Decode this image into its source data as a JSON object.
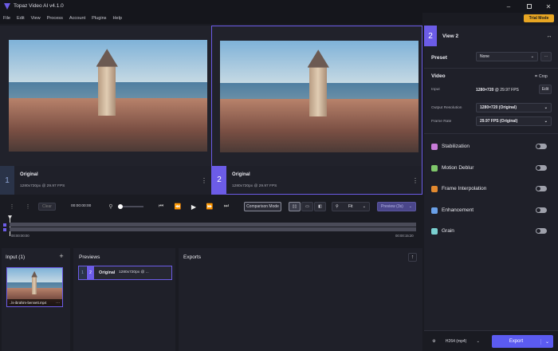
{
  "app": {
    "title": "Topaz Video AI  v4.1.0",
    "trial": "Trial Mode"
  },
  "menu": [
    "File",
    "Edit",
    "View",
    "Process",
    "Account",
    "Plugins",
    "Help"
  ],
  "viewers": [
    {
      "num": "1",
      "name": "Original",
      "info": "1280x720px @ 29.97 FPS"
    },
    {
      "num": "2",
      "name": "Original",
      "info": "1280x720px @ 29.97 FPS"
    }
  ],
  "timeline": {
    "clear": "Clear",
    "time": "00:00:00:00",
    "comparison": "Comparison Mode",
    "zoom": "Fit",
    "preview": "Preview (3s)",
    "start": "00:00:00:00",
    "end": "00:00:15:20"
  },
  "input": {
    "title": "Input (1)",
    "file": "..ls-ibrahim-bennett.mp4"
  },
  "previews": {
    "title": "Previews",
    "num_a": "1",
    "num_b": "2",
    "name": "Original",
    "info": "1280x720px @ ..."
  },
  "exports": {
    "title": "Exports"
  },
  "side": {
    "view_num": "2",
    "view_title": "View 2",
    "preset_label": "Preset",
    "preset_value": "None",
    "video_label": "Video",
    "crop": "Crop",
    "input_label": "Input",
    "input_value_a": "1280×720",
    "input_value_b": "@ 29.97 FPS",
    "edit": "Edit",
    "res_label": "Output Resolution",
    "res_value": "1280×720 (Original)",
    "fr_label": "Frame Rate",
    "fr_value": "29.97 FPS (Original)",
    "features": [
      {
        "name": "Stabilization",
        "icon": "stabilization-icon",
        "color": "#c77bd8"
      },
      {
        "name": "Motion Deblur",
        "icon": "motion-deblur-icon",
        "color": "#7fc76b"
      },
      {
        "name": "Frame Interpolation",
        "icon": "frame-interpolation-icon",
        "color": "#e2892f"
      },
      {
        "name": "Enhancement",
        "icon": "enhancement-icon",
        "color": "#6aa0e8"
      },
      {
        "name": "Grain",
        "icon": "grain-icon",
        "color": "#7ad0d0"
      }
    ],
    "codec": "H264 (mp4)",
    "export": "Export"
  },
  "colors": {
    "accent": "#6c5ce7",
    "trial": "#e8a623"
  }
}
